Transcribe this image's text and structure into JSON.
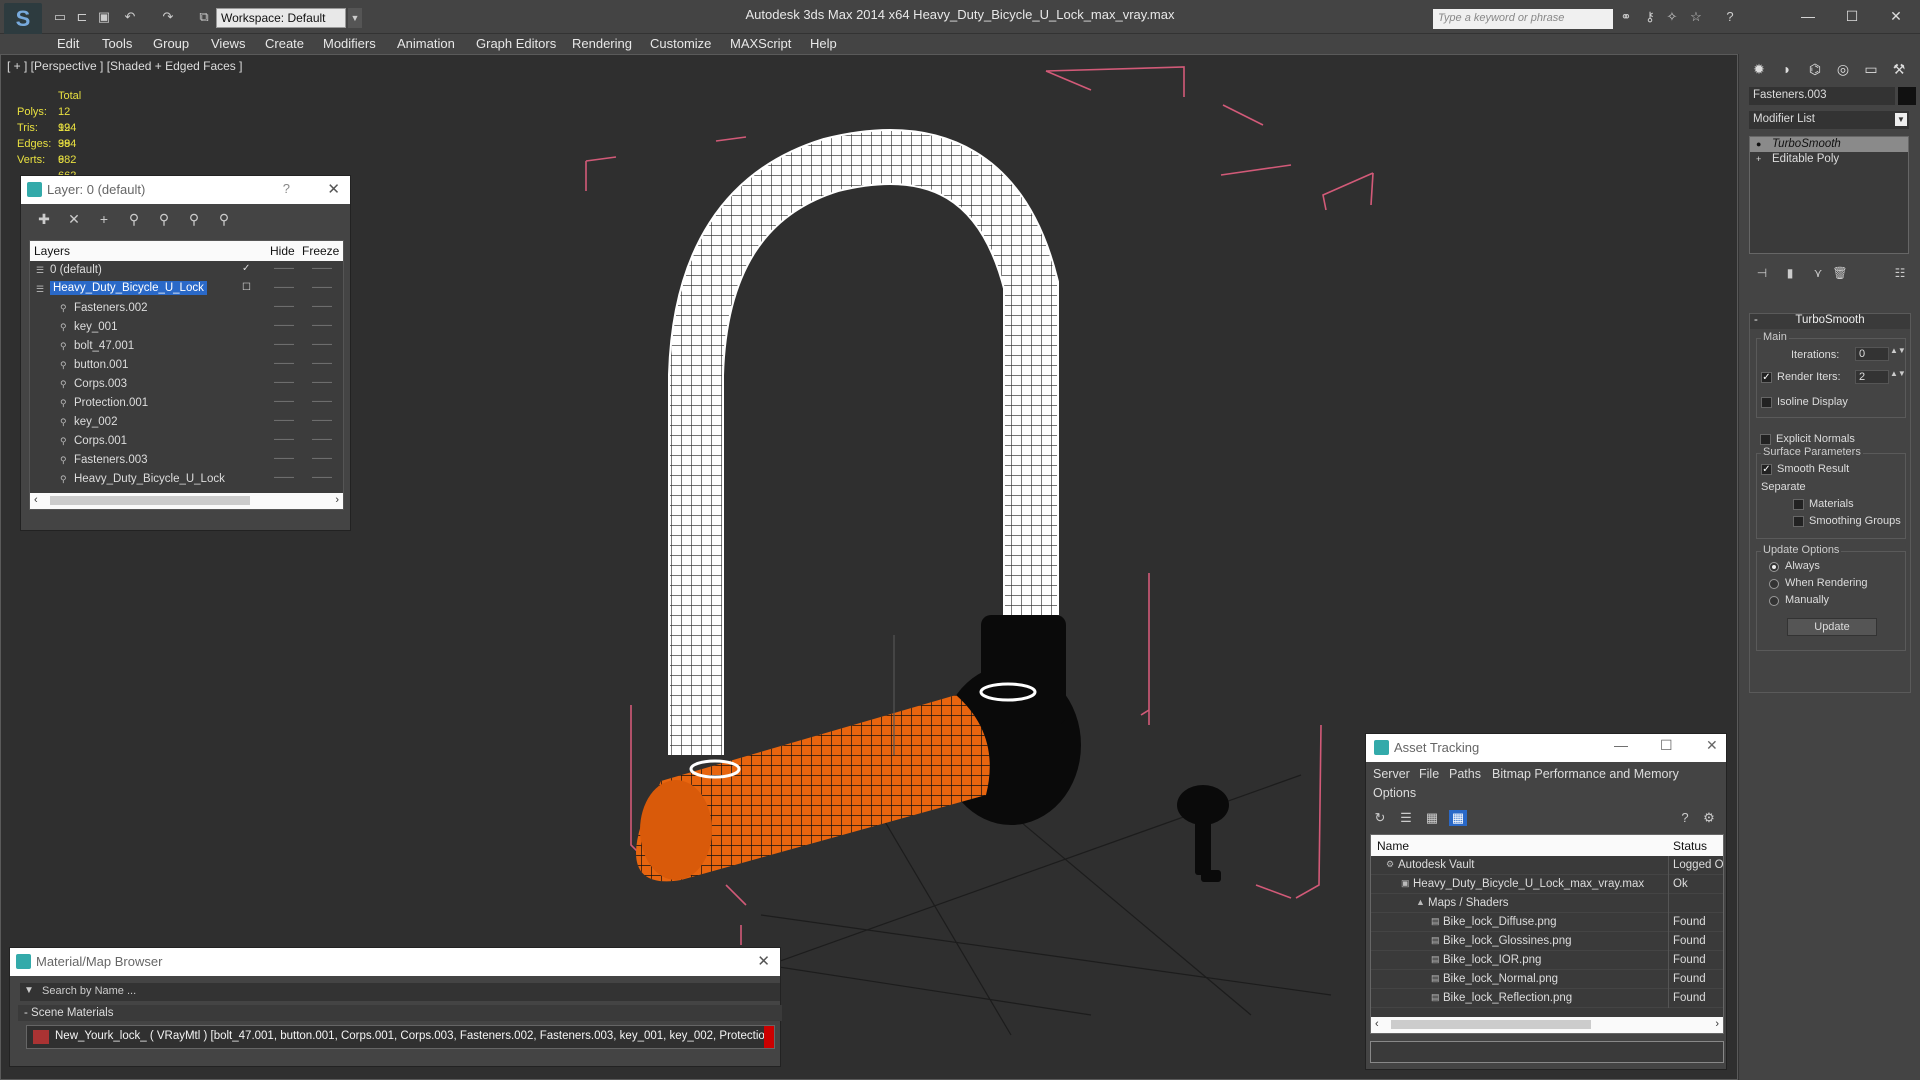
{
  "window": {
    "title": "Autodesk 3ds Max  2014 x64      Heavy_Duty_Bicycle_U_Lock_max_vray.max",
    "workspace": "Workspace: Default",
    "search_placeholder": "Type a keyword or phrase"
  },
  "menu": [
    "Edit",
    "Tools",
    "Group",
    "Views",
    "Create",
    "Modifiers",
    "Animation",
    "Graph Editors",
    "Rendering",
    "Customize",
    "MAXScript",
    "Help"
  ],
  "viewport": {
    "label": "[ + ] [Perspective ] [Shaded + Edged Faces ]",
    "stats": {
      "header": "Total",
      "rows": [
        {
          "label": "Polys:",
          "value": "12 994"
        },
        {
          "label": "Tris:",
          "value": "12 994"
        },
        {
          "label": "Edges:",
          "value": "38 982"
        },
        {
          "label": "Verts:",
          "value": "6 662"
        }
      ]
    }
  },
  "layer_window": {
    "title": "Layer: 0 (default)",
    "help": "?",
    "columns": {
      "layers": "Layers",
      "hide": "Hide",
      "freeze": "Freeze"
    },
    "rows": [
      {
        "name": "0 (default)",
        "indent": 0,
        "type": "layer"
      },
      {
        "name": "Heavy_Duty_Bicycle_U_Lock",
        "indent": 0,
        "type": "layer",
        "selected": true
      },
      {
        "name": "Fasteners.002",
        "indent": 1,
        "type": "object"
      },
      {
        "name": "key_001",
        "indent": 1,
        "type": "object"
      },
      {
        "name": "bolt_47.001",
        "indent": 1,
        "type": "object"
      },
      {
        "name": "button.001",
        "indent": 1,
        "type": "object"
      },
      {
        "name": "Corps.003",
        "indent": 1,
        "type": "object"
      },
      {
        "name": "Protection.001",
        "indent": 1,
        "type": "object"
      },
      {
        "name": "key_002",
        "indent": 1,
        "type": "object"
      },
      {
        "name": "Corps.001",
        "indent": 1,
        "type": "object"
      },
      {
        "name": "Fasteners.003",
        "indent": 1,
        "type": "object"
      },
      {
        "name": "Heavy_Duty_Bicycle_U_Lock",
        "indent": 1,
        "type": "object"
      }
    ]
  },
  "material_browser": {
    "title": "Material/Map Browser",
    "search_placeholder": "Search by Name ...",
    "section": "- Scene Materials",
    "material": "New_Yourk_lock_  ( VRayMtl )  [bolt_47.001, button.001, Corps.001, Corps.003, Fasteners.002, Fasteners.003, key_001, key_002, Protectio..."
  },
  "asset_tracking": {
    "title": "Asset Tracking",
    "menu": [
      "Server",
      "File",
      "Paths",
      "Bitmap Performance and Memory",
      "Options"
    ],
    "columns": {
      "name": "Name",
      "status": "Status"
    },
    "rows": [
      {
        "name": "Autodesk Vault",
        "status": "Logged O",
        "indent": 1
      },
      {
        "name": "Heavy_Duty_Bicycle_U_Lock_max_vray.max",
        "status": "Ok",
        "indent": 2
      },
      {
        "name": "Maps / Shaders",
        "status": "",
        "indent": 3
      },
      {
        "name": "Bike_lock_Diffuse.png",
        "status": "Found",
        "indent": 4
      },
      {
        "name": "Bike_lock_Glossines.png",
        "status": "Found",
        "indent": 4
      },
      {
        "name": "Bike_lock_IOR.png",
        "status": "Found",
        "indent": 4
      },
      {
        "name": "Bike_lock_Normal.png",
        "status": "Found",
        "indent": 4
      },
      {
        "name": "Bike_lock_Reflection.png",
        "status": "Found",
        "indent": 4
      }
    ]
  },
  "command_panel": {
    "object_name": "Fasteners.003",
    "modifier_list": "Modifier List",
    "stack": [
      "TurboSmooth",
      "Editable Poly"
    ],
    "rollout_title": "TurboSmooth",
    "main_group": "Main",
    "iterations_label": "Iterations:",
    "iterations_value": "0",
    "render_iters_label": "Render Iters:",
    "render_iters_value": "2",
    "render_iters_checked": true,
    "isoline_label": "Isoline Display",
    "explicit_normals_label": "Explicit Normals",
    "surface_group": "Surface Parameters",
    "smooth_result_label": "Smooth Result",
    "separate_label": "Separate",
    "materials_label": "Materials",
    "smoothing_groups_label": "Smoothing Groups",
    "update_group": "Update Options",
    "always_label": "Always",
    "when_rendering_label": "When Rendering",
    "manually_label": "Manually",
    "update_button": "Update"
  },
  "colors": {
    "lock_orange": "#e8650f",
    "selection_blue": "#2a69c8",
    "bbox_pink": "#d25a78",
    "stats_yellow": "#e8e040"
  }
}
